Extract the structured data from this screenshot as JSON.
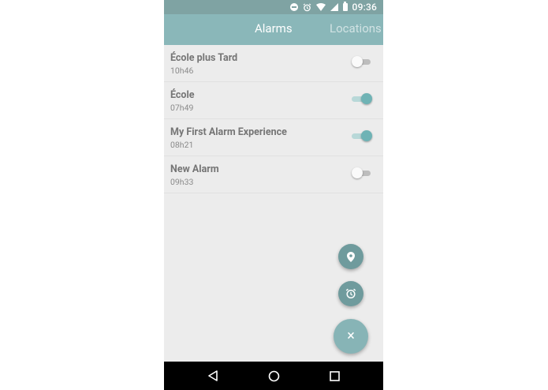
{
  "status_bar": {
    "time": "09:36"
  },
  "tabs": [
    {
      "label": "Alarms",
      "active": true
    },
    {
      "label": "Locations",
      "active": false
    }
  ],
  "alarms": [
    {
      "title": "École plus Tard",
      "time": "10h46",
      "enabled": false
    },
    {
      "title": "École",
      "time": "07h49",
      "enabled": true
    },
    {
      "title": "My First Alarm Experience",
      "time": "08h21",
      "enabled": true
    },
    {
      "title": "New Alarm",
      "time": "09h33",
      "enabled": false
    }
  ],
  "fabs": {
    "location_icon": "location-pin-icon",
    "alarm_icon": "alarm-clock-icon",
    "close_icon": "close-icon",
    "close_glyph": "×"
  },
  "colors": {
    "status_bar": "#7fa3a3",
    "app_bar": "#8ab7b9",
    "accent": "#6fb3b5",
    "fab_small": "#6f9b9d",
    "fab_main": "#87b4b6"
  }
}
